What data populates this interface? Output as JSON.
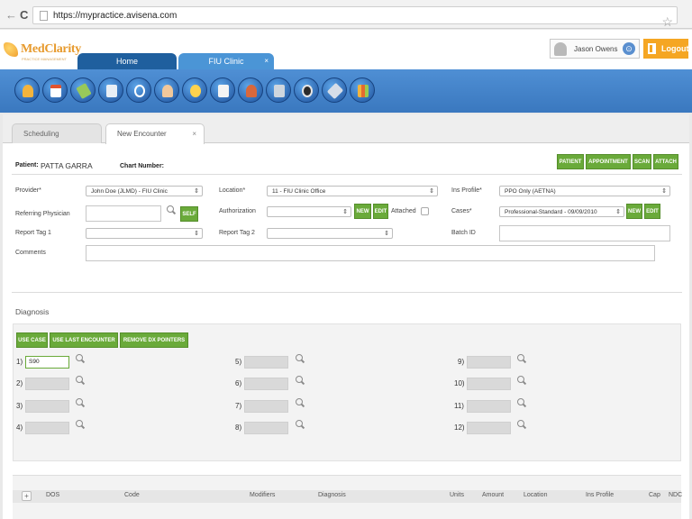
{
  "browser": {
    "url": "https://mypractice.avisena.com",
    "back": "←",
    "reload": "C",
    "star": "☆"
  },
  "header": {
    "logo_text": "MedClarity",
    "logo_tagline": "PRACTICE MANAGEMENT",
    "tabs": [
      {
        "label": "Home"
      },
      {
        "label": "FIU Clinic",
        "close": "×"
      }
    ],
    "user_name": "Jason Owens",
    "user_options_icon": "⊙",
    "logout_label": "Logout"
  },
  "toolbar": {
    "icons": [
      "patients-icon",
      "calendar-icon",
      "charges-icon",
      "documents-icon",
      "timer-icon",
      "provider-icon",
      "reports-icon",
      "billing-icon",
      "staff-icon",
      "files-icon",
      "record-icon",
      "satellite-icon",
      "analytics-icon"
    ]
  },
  "subtabs": [
    {
      "label": "Scheduling"
    },
    {
      "label": "New Encounter",
      "close": "×"
    }
  ],
  "patient": {
    "label": "Patient:",
    "name": "PATTA GARRA",
    "chart_label": "Chart Number:"
  },
  "actions": [
    "PATIENT",
    "APPOINTMENT",
    "SCAN",
    "ATTACH"
  ],
  "form": {
    "provider_label": "Provider*",
    "provider_value": "John Doe (JLMD) - FIU Clinic",
    "location_label": "Location*",
    "location_value": "11 - FIU Clinic Office",
    "ins_profile_label": "Ins Profile*",
    "ins_profile_value": "PPO Only (AETNA)",
    "referring_label": "Referring Physician",
    "self_label": "SELF",
    "authorization_label": "Authorization",
    "new_label": "NEW",
    "edit_label": "EDIT",
    "attached_label": "Attached",
    "cases_label": "Cases*",
    "cases_value": "Professional-Standard - 09/09/2010",
    "report_tag1_label": "Report Tag 1",
    "report_tag2_label": "Report Tag 2",
    "batch_label": "Batch ID",
    "comments_label": "Comments"
  },
  "diagnosis": {
    "title": "Diagnosis",
    "buttons": [
      "USE CASE",
      "USE LAST ENCOUNTER",
      "REMOVE DX POINTERS"
    ],
    "slots": [
      {
        "label": "1)",
        "value": "S90"
      },
      {
        "label": "2)",
        "value": ""
      },
      {
        "label": "3)",
        "value": ""
      },
      {
        "label": "4)",
        "value": ""
      },
      {
        "label": "5)",
        "value": ""
      },
      {
        "label": "6)",
        "value": ""
      },
      {
        "label": "7)",
        "value": ""
      },
      {
        "label": "8)",
        "value": ""
      },
      {
        "label": "9)",
        "value": ""
      },
      {
        "label": "10)",
        "value": ""
      },
      {
        "label": "11)",
        "value": ""
      },
      {
        "label": "12)",
        "value": ""
      }
    ]
  },
  "grid": {
    "add": "+",
    "columns": [
      "DOS",
      "Code",
      "Modifiers",
      "Diagnosis",
      "Units",
      "Amount",
      "Location",
      "Ins Profile",
      "Cap",
      "NDC"
    ]
  },
  "colors": {
    "accent_blue": "#3a78bf",
    "green": "#6aaa3a",
    "orange": "#f5a623"
  }
}
